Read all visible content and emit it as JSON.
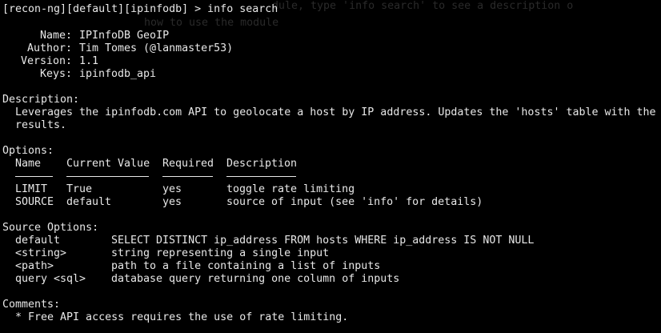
{
  "ghost_text": {
    "line1": "dule, type 'info search' to see a description o",
    "line2": "how to use the module"
  },
  "prompt": {
    "text": "[recon-ng][default][ipinfodb] > info search"
  },
  "info": {
    "name_label": "Name:",
    "name_value": "IPInfoDB GeoIP",
    "author_label": "Author:",
    "author_value": "Tim Tomes (@lanmaster53)",
    "version_label": "Version:",
    "version_value": "1.1",
    "keys_label": "Keys:",
    "keys_value": "ipinfodb_api"
  },
  "description": {
    "heading": "Description:",
    "line1": "Leverages the ipinfodb.com API to geolocate a host by IP address. Updates the 'hosts' table with the",
    "line2": "results."
  },
  "options": {
    "heading": "Options:",
    "headers": {
      "name": "Name",
      "current_value": "Current Value",
      "required": "Required",
      "description": "Description"
    },
    "rows": [
      {
        "name": "LIMIT",
        "current_value": "True",
        "required": "yes",
        "description": "toggle rate limiting"
      },
      {
        "name": "SOURCE",
        "current_value": "default",
        "required": "yes",
        "description": "source of input (see 'info' for details)"
      }
    ]
  },
  "source_options": {
    "heading": "Source Options:",
    "rows": [
      {
        "key": "default",
        "value": "SELECT DISTINCT ip_address FROM hosts WHERE ip_address IS NOT NULL"
      },
      {
        "key": "<string>",
        "value": "string representing a single input"
      },
      {
        "key": "<path>",
        "value": "path to a file containing a list of inputs"
      },
      {
        "key": "query <sql>",
        "value": "database query returning one column of inputs"
      }
    ]
  },
  "comments": {
    "heading": "Comments:",
    "line1": "* Free API access requires the use of rate limiting."
  }
}
